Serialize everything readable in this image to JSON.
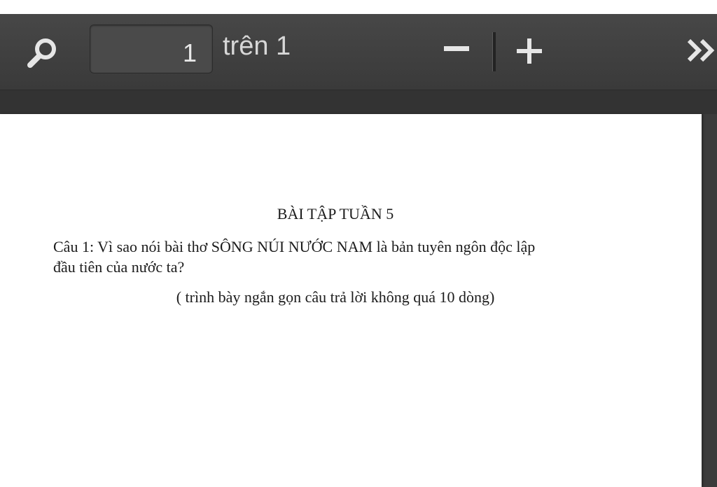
{
  "toolbar": {
    "current_page": "1",
    "page_total": "trên 1",
    "icons": {
      "search": "search-icon",
      "zoom_out": "minus-icon",
      "zoom_in": "plus-icon",
      "more": "double-chevron-right-icon"
    },
    "colors": {
      "toolbar_bg": "#3f3f3f",
      "icon": "#e6e6e6",
      "text": "#d7d7d7"
    }
  },
  "document": {
    "title": "BÀI TẬP TUẦN 5",
    "question_line1": "Câu 1: Vì sao nói bài thơ  SÔNG NÚI NƯỚC NAM là bản  tuyên ngôn độc  lập",
    "question_line2": "đầu tiên của nước ta?",
    "instruction": "( trình bày ngắn gọn câu trả lời không quá 10 dòng)"
  }
}
